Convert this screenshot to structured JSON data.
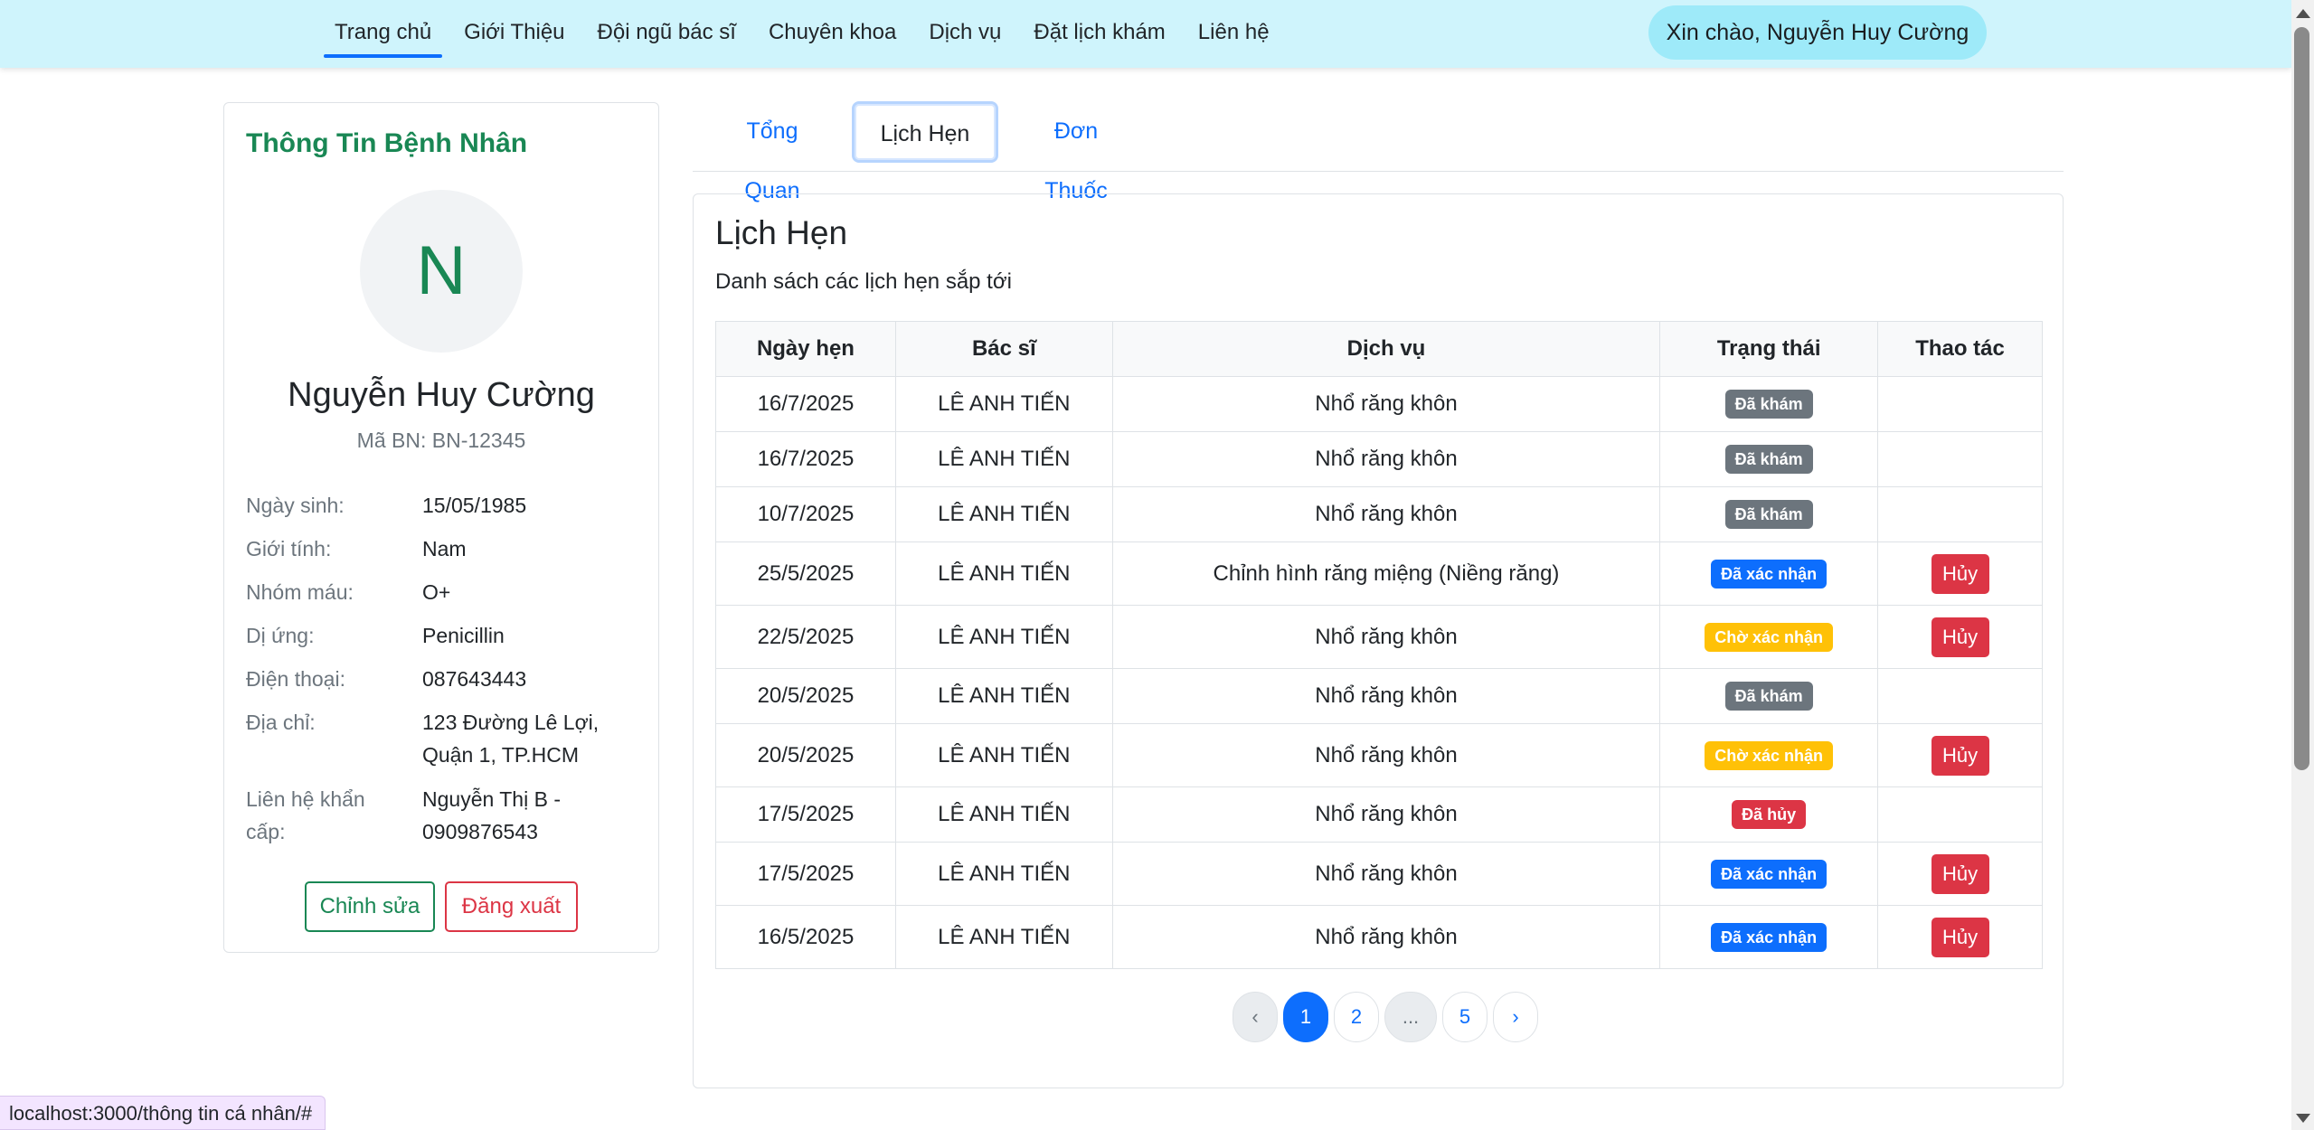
{
  "nav": {
    "links": [
      "Trang chủ",
      "Giới Thiệu",
      "Đội ngũ bác sĩ",
      "Chuyên khoa",
      "Dịch vụ",
      "Đặt lịch khám",
      "Liên hệ"
    ],
    "active": "Trang chủ",
    "greeting": "Xin chào, Nguyễn Huy Cường"
  },
  "patient": {
    "heading": "Thông Tin Bệnh Nhân",
    "avatar_initial": "N",
    "name": "Nguyễn Huy Cường",
    "id_line": "Mã BN: BN-12345",
    "fields": [
      {
        "label": "Ngày sinh:",
        "value": "15/05/1985"
      },
      {
        "label": "Giới tính:",
        "value": "Nam"
      },
      {
        "label": "Nhóm máu:",
        "value": "O+"
      },
      {
        "label": "Dị ứng:",
        "value": "Penicillin"
      },
      {
        "label": "Điện thoại:",
        "value": "087643443"
      },
      {
        "label": "Địa chỉ:",
        "value": "123 Đường Lê Lợi, Quận 1, TP.HCM"
      },
      {
        "label": "Liên hệ khẩn cấp:",
        "value": "Nguyễn Thị B - 0909876543"
      }
    ],
    "edit_label": "Chỉnh sửa",
    "logout_label": "Đăng xuất"
  },
  "tabs": {
    "overview": "Tổng Quan",
    "appointments": "Lịch Hẹn",
    "prescriptions": "Đơn Thuốc"
  },
  "appointments": {
    "title": "Lịch Hẹn",
    "subtitle": "Danh sách các lịch hẹn sắp tới",
    "columns": [
      "Ngày hẹn",
      "Bác sĩ",
      "Dịch vụ",
      "Trạng thái",
      "Thao tác"
    ],
    "cancel_label": "Hủy",
    "rows": [
      {
        "date": "16/7/2025",
        "doctor": "LÊ ANH TIẾN",
        "service": "Nhổ răng khôn",
        "status": "Đã khám",
        "cancel": false
      },
      {
        "date": "16/7/2025",
        "doctor": "LÊ ANH TIẾN",
        "service": "Nhổ răng khôn",
        "status": "Đã khám",
        "cancel": false
      },
      {
        "date": "10/7/2025",
        "doctor": "LÊ ANH TIẾN",
        "service": "Nhổ răng khôn",
        "status": "Đã khám",
        "cancel": false
      },
      {
        "date": "25/5/2025",
        "doctor": "LÊ ANH TIẾN",
        "service": "Chỉnh hình răng miệng (Niềng răng)",
        "status": "Đã xác nhận",
        "cancel": true
      },
      {
        "date": "22/5/2025",
        "doctor": "LÊ ANH TIẾN",
        "service": "Nhổ răng khôn",
        "status": "Chờ xác nhận",
        "cancel": true
      },
      {
        "date": "20/5/2025",
        "doctor": "LÊ ANH TIẾN",
        "service": "Nhổ răng khôn",
        "status": "Đã khám",
        "cancel": false
      },
      {
        "date": "20/5/2025",
        "doctor": "LÊ ANH TIẾN",
        "service": "Nhổ răng khôn",
        "status": "Chờ xác nhận",
        "cancel": true
      },
      {
        "date": "17/5/2025",
        "doctor": "LÊ ANH TIẾN",
        "service": "Nhổ răng khôn",
        "status": "Đã hủy",
        "cancel": false
      },
      {
        "date": "17/5/2025",
        "doctor": "LÊ ANH TIẾN",
        "service": "Nhổ răng khôn",
        "status": "Đã xác nhận",
        "cancel": true
      },
      {
        "date": "16/5/2025",
        "doctor": "LÊ ANH TIẾN",
        "service": "Nhổ răng khôn",
        "status": "Đã xác nhận",
        "cancel": true
      }
    ],
    "status_colors": {
      "Đã khám": "#6c757d",
      "Đã xác nhận": "#0d6efd",
      "Chờ xác nhận": "#ffc107",
      "Đã hủy": "#dc3545"
    }
  },
  "pagination": {
    "prev": "‹",
    "pages": [
      "1",
      "2",
      "...",
      "5"
    ],
    "current": "1",
    "next": "›"
  },
  "status_bar": {
    "url": "localhost:3000/thông tin cá nhân/#"
  }
}
